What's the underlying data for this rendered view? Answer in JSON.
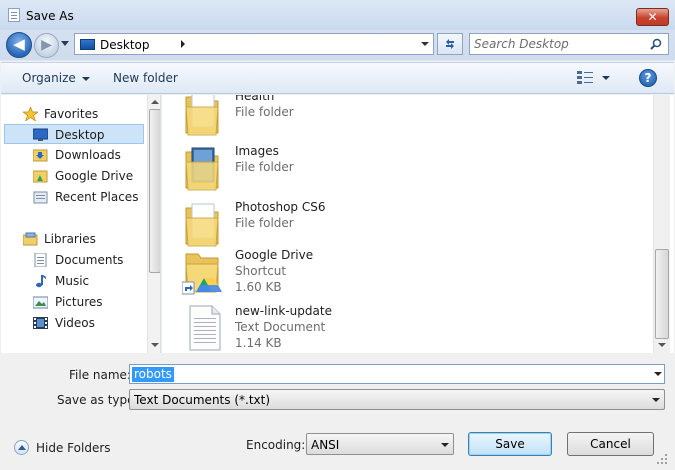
{
  "window": {
    "title": "Save As",
    "close_label": "✕"
  },
  "nav": {
    "back_label": "◀",
    "forward_label": "▶"
  },
  "address": {
    "location": "Desktop"
  },
  "search": {
    "placeholder": "Search Desktop"
  },
  "toolbar": {
    "organize_label": "Organize",
    "new_folder_label": "New folder",
    "help_label": "?"
  },
  "sidebar": {
    "items": [
      {
        "label": "Favorites",
        "icon": "star-icon",
        "selected": false
      },
      {
        "label": "Desktop",
        "icon": "desktop-icon",
        "selected": true
      },
      {
        "label": "Downloads",
        "icon": "downloads-folder-icon",
        "selected": false
      },
      {
        "label": "Google Drive",
        "icon": "google-drive-folder-icon",
        "selected": false
      },
      {
        "label": "Recent Places",
        "icon": "recent-places-icon",
        "selected": false
      },
      {
        "label": "Libraries",
        "icon": "libraries-icon",
        "selected": false
      },
      {
        "label": "Documents",
        "icon": "documents-icon",
        "selected": false
      },
      {
        "label": "Music",
        "icon": "music-icon",
        "selected": false
      },
      {
        "label": "Pictures",
        "icon": "pictures-icon",
        "selected": false
      },
      {
        "label": "Videos",
        "icon": "videos-icon",
        "selected": false
      }
    ]
  },
  "files": [
    {
      "name": "Health",
      "type": "File folder",
      "size": "",
      "icon": "folder-icon"
    },
    {
      "name": "Images",
      "type": "File folder",
      "size": "",
      "icon": "folder-icon"
    },
    {
      "name": "Photoshop CS6",
      "type": "File folder",
      "size": "",
      "icon": "folder-icon"
    },
    {
      "name": "Google Drive",
      "type": "Shortcut",
      "size": "1.60 KB",
      "icon": "google-drive-shortcut-icon"
    },
    {
      "name": "new-link-update",
      "type": "Text Document",
      "size": "1.14 KB",
      "icon": "text-document-icon"
    }
  ],
  "form": {
    "file_name_label": "File name:",
    "file_name_value": "robots",
    "save_type_label": "Save as type:",
    "save_type_value": "Text Documents (*.txt)",
    "encoding_label": "Encoding:",
    "encoding_value": "ANSI",
    "hide_folders_label": "Hide Folders",
    "save_label": "Save",
    "cancel_label": "Cancel"
  },
  "colors": {
    "accent": "#3399ff",
    "selection_bg": "#cde3f7",
    "close_red": "#c7432e"
  }
}
